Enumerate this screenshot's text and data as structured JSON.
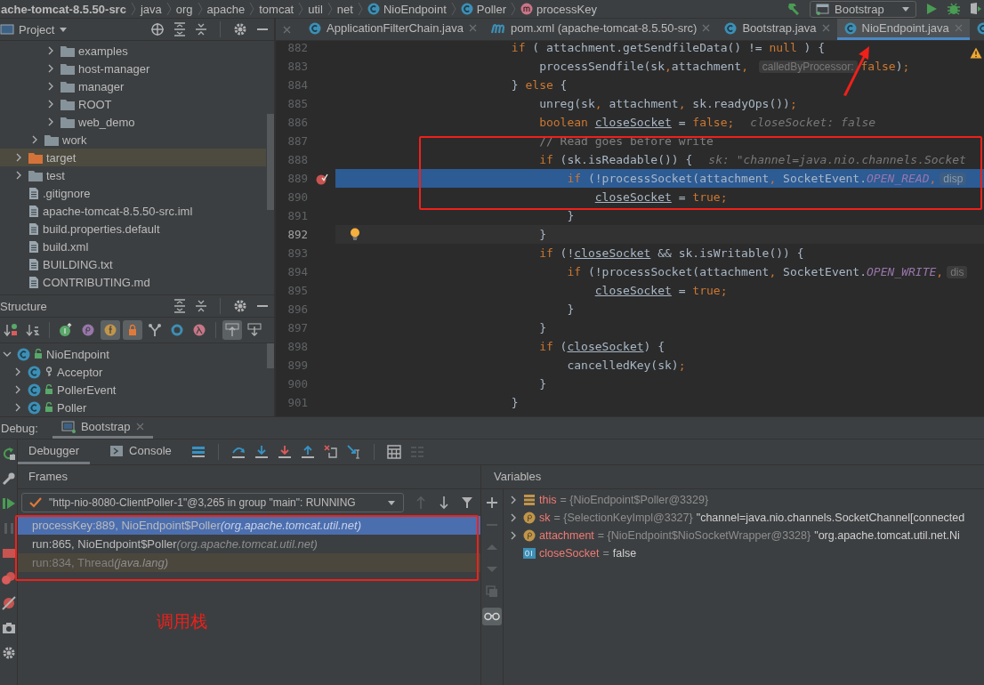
{
  "breadcrumbs": [
    {
      "label": "ache-tomcat-8.5.50-src",
      "kind": "dir"
    },
    {
      "label": "java",
      "kind": "dir"
    },
    {
      "label": "org",
      "kind": "dir"
    },
    {
      "label": "apache",
      "kind": "dir"
    },
    {
      "label": "tomcat",
      "kind": "dir"
    },
    {
      "label": "util",
      "kind": "dir"
    },
    {
      "label": "net",
      "kind": "dir"
    },
    {
      "label": "NioEndpoint",
      "kind": "class"
    },
    {
      "label": "Poller",
      "kind": "class"
    },
    {
      "label": "processKey",
      "kind": "method"
    }
  ],
  "run_config": {
    "label": "Bootstrap"
  },
  "project_panel": {
    "title": "Project",
    "tree": [
      {
        "children": [
          {
            "children": [
              {
                "children": [
                  {
                    "label": "examples",
                    "kind": "folder",
                    "expanded": false
                  },
                  {
                    "label": "host-manager",
                    "kind": "folder",
                    "expanded": false
                  },
                  {
                    "label": "manager",
                    "kind": "folder",
                    "expanded": false
                  },
                  {
                    "label": "ROOT",
                    "kind": "folder",
                    "expanded": false
                  },
                  {
                    "label": "web_demo",
                    "kind": "folder",
                    "expanded": false
                  }
                ]
              },
              {
                "label": "work",
                "kind": "folder",
                "expanded": false
              }
            ]
          },
          {
            "label": "target",
            "kind": "excluded-folder",
            "expanded": false
          },
          {
            "label": "test",
            "kind": "folder",
            "expanded": false
          },
          {
            "label": ".gitignore",
            "kind": "file"
          },
          {
            "label": "apache-tomcat-8.5.50-src.iml",
            "kind": "file"
          },
          {
            "label": "build.properties.default",
            "kind": "file"
          },
          {
            "label": "build.xml",
            "kind": "file"
          },
          {
            "label": "BUILDING.txt",
            "kind": "file"
          },
          {
            "label": "CONTRIBUTING.md",
            "kind": "file"
          }
        ]
      }
    ]
  },
  "structure_panel": {
    "title": "Structure",
    "tools": [
      {
        "kind": "sort-visibility",
        "on": false
      },
      {
        "kind": "sort-alpha",
        "on": false
      },
      {
        "kind": "inherited",
        "on": false
      },
      {
        "kind": "properties",
        "on": false
      },
      {
        "kind": "fields",
        "on": true
      },
      {
        "kind": "non-public",
        "on": true
      },
      {
        "kind": "hierarchy",
        "on": false
      },
      {
        "kind": "anonymous",
        "on": false
      },
      {
        "kind": "lambdas",
        "on": false
      },
      {
        "kind": "scroll-to-source",
        "on": true
      },
      {
        "kind": "scroll-from-source",
        "on": false
      }
    ],
    "tree": [
      {
        "label": "NioEndpoint",
        "kind": "public-class",
        "expanded": true,
        "children": [
          {
            "label": "Acceptor",
            "kind": "package-class",
            "expanded": false
          },
          {
            "label": "PollerEvent",
            "kind": "public-class",
            "expanded": false
          },
          {
            "label": "Poller",
            "kind": "public-class",
            "expanded": false
          }
        ]
      }
    ]
  },
  "editor_tabs": [
    {
      "label": "ApplicationFilterChain.java",
      "kind": "class",
      "selected": false
    },
    {
      "label": "pom.xml (apache-tomcat-8.5.50-src)",
      "kind": "maven",
      "selected": false
    },
    {
      "label": "Bootstrap.java",
      "kind": "class",
      "selected": false
    },
    {
      "label": "NioEndpoint.java",
      "kind": "class",
      "selected": true
    },
    {
      "kind": "class",
      "selected": false
    }
  ],
  "code_lines": [
    {
      "number": "882",
      "tokens": [
        {
          "kind": "keyword",
          "text": "if"
        },
        {
          "kind": "plain",
          "text": " ( attachment.getSendfileData() != "
        },
        {
          "kind": "keyword",
          "text": "null"
        },
        {
          "kind": "plain",
          "text": " ) {"
        }
      ]
    },
    {
      "number": "883",
      "tokens": [
        {
          "kind": "plain",
          "text": "processSendfile(sk"
        },
        {
          "kind": "keyword",
          "text": ","
        },
        {
          "kind": "plain",
          "text": "attachment"
        },
        {
          "kind": "keyword",
          "text": ", "
        },
        {
          "kind": "hint",
          "text": "calledByProcessor:"
        },
        {
          "kind": "keyword",
          "text": "false"
        },
        {
          "kind": "plain",
          "text": ")"
        },
        {
          "kind": "keyword",
          "text": ";"
        }
      ]
    },
    {
      "number": "884",
      "tokens": [
        {
          "kind": "plain",
          "text": "} "
        },
        {
          "kind": "keyword",
          "text": "else"
        },
        {
          "kind": "plain",
          "text": " {"
        }
      ]
    },
    {
      "number": "885",
      "tokens": [
        {
          "kind": "plain",
          "text": "unreg(sk"
        },
        {
          "kind": "keyword",
          "text": ","
        },
        {
          "kind": "plain",
          "text": " attachment"
        },
        {
          "kind": "keyword",
          "text": ","
        },
        {
          "kind": "plain",
          "text": " sk.readyOps())"
        },
        {
          "kind": "keyword",
          "text": ";"
        }
      ]
    },
    {
      "number": "886",
      "tokens": [
        {
          "kind": "keyword",
          "text": "boolean "
        },
        {
          "kind": "field",
          "text": "closeSocket"
        },
        {
          "kind": "plain",
          "text": " = "
        },
        {
          "kind": "keyword",
          "text": "false;"
        },
        {
          "kind": "debug",
          "text": "closeSocket: false"
        }
      ]
    },
    {
      "number": "887",
      "tokens": [
        {
          "kind": "comment",
          "text": "// Read goes before write"
        }
      ]
    },
    {
      "number": "888",
      "tokens": [
        {
          "kind": "keyword",
          "text": "if"
        },
        {
          "kind": "plain",
          "text": " (sk.isReadable()) {"
        },
        {
          "kind": "debug",
          "text": "sk: \"channel=java.nio.channels.Socket"
        }
      ]
    },
    {
      "number": "889",
      "execution": true,
      "breakpoint": true,
      "tokens": [
        {
          "kind": "keyword",
          "text": "if"
        },
        {
          "kind": "plain",
          "text": " (!processSocket(attachment"
        },
        {
          "kind": "keyword",
          "text": ","
        },
        {
          "kind": "plain",
          "text": " SocketEvent."
        },
        {
          "kind": "constant",
          "text": "OPEN_READ"
        },
        {
          "kind": "keyword",
          "text": ","
        },
        {
          "kind": "hint",
          "text": "disp"
        }
      ]
    },
    {
      "number": "890",
      "tokens": [
        {
          "kind": "field",
          "text": "closeSocket"
        },
        {
          "kind": "plain",
          "text": " = "
        },
        {
          "kind": "keyword",
          "text": "true;"
        }
      ]
    },
    {
      "number": "891",
      "tokens": [
        {
          "kind": "plain",
          "text": "}"
        }
      ]
    },
    {
      "number": "892",
      "caret_line": true,
      "bulb": true,
      "tokens": [
        {
          "kind": "plain",
          "text": "}"
        }
      ]
    },
    {
      "number": "893",
      "tokens": [
        {
          "kind": "keyword",
          "text": "if"
        },
        {
          "kind": "plain",
          "text": " (!"
        },
        {
          "kind": "field",
          "text": "closeSocket"
        },
        {
          "kind": "plain",
          "text": " && sk.isWritable()) {"
        }
      ]
    },
    {
      "number": "894",
      "tokens": [
        {
          "kind": "keyword",
          "text": "if"
        },
        {
          "kind": "plain",
          "text": " (!processSocket(attachment"
        },
        {
          "kind": "keyword",
          "text": ","
        },
        {
          "kind": "plain",
          "text": " SocketEvent."
        },
        {
          "kind": "constant",
          "text": "OPEN_WRITE"
        },
        {
          "kind": "keyword",
          "text": ","
        },
        {
          "kind": "hint",
          "text": "dis"
        }
      ]
    },
    {
      "number": "895",
      "tokens": [
        {
          "kind": "field",
          "text": "closeSocket"
        },
        {
          "kind": "plain",
          "text": " = "
        },
        {
          "kind": "keyword",
          "text": "true;"
        }
      ]
    },
    {
      "number": "896",
      "tokens": [
        {
          "kind": "plain",
          "text": "}"
        }
      ]
    },
    {
      "number": "897",
      "tokens": [
        {
          "kind": "plain",
          "text": "}"
        }
      ]
    },
    {
      "number": "898",
      "tokens": [
        {
          "kind": "keyword",
          "text": "if"
        },
        {
          "kind": "plain",
          "text": " ("
        },
        {
          "kind": "field",
          "text": "closeSocket"
        },
        {
          "kind": "plain",
          "text": ") {"
        }
      ]
    },
    {
      "number": "899",
      "tokens": [
        {
          "kind": "plain",
          "text": "cancelledKey(sk)"
        },
        {
          "kind": "keyword",
          "text": ";"
        }
      ]
    },
    {
      "number": "900",
      "tokens": [
        {
          "kind": "plain",
          "text": "}"
        }
      ]
    },
    {
      "number": "901",
      "tokens": [
        {
          "kind": "plain",
          "text": "}"
        }
      ]
    }
  ],
  "debug": {
    "label": "Debug:",
    "session_tab": {
      "label": "Bootstrap",
      "selected": true
    },
    "tabs": [
      {
        "label": "Debugger",
        "kind": "debugger",
        "selected": true
      },
      {
        "label": "Console",
        "kind": "console",
        "selected": false
      }
    ],
    "frames_title": "Frames",
    "thread": "\"http-nio-8080-ClientPoller-1\"@3,265 in group \"main\": RUNNING",
    "frames": [
      {
        "method": "processKey:889, NioEndpoint$Poller",
        "package": "(org.apache.tomcat.util.net)",
        "kind": "app",
        "selected": true
      },
      {
        "method": "run:865, NioEndpoint$Poller",
        "package": "(org.apache.tomcat.util.net)",
        "kind": "app",
        "selected": false
      },
      {
        "method": "run:834, Thread",
        "package": "(java.lang)",
        "kind": "library",
        "selected": false
      }
    ],
    "variables_title": "Variables",
    "variables": [
      {
        "name": "this",
        "kind": "object",
        "expandable": true,
        "detail": "= {NioEndpoint$Poller@3329}"
      },
      {
        "name": "sk",
        "kind": "param",
        "expandable": true,
        "detail": "= {SelectionKeyImpl@3327}",
        "value": "\"channel=java.nio.channels.SocketChannel[connected"
      },
      {
        "name": "attachment",
        "kind": "param",
        "expandable": true,
        "detail": "= {NioEndpoint$NioSocketWrapper@3328}",
        "value": "\"org.apache.tomcat.util.net.Ni"
      },
      {
        "name": "closeSocket",
        "kind": "primitive",
        "expandable": false,
        "detail": "=",
        "value": "false"
      }
    ]
  },
  "annotation": {
    "label": "调用栈"
  }
}
